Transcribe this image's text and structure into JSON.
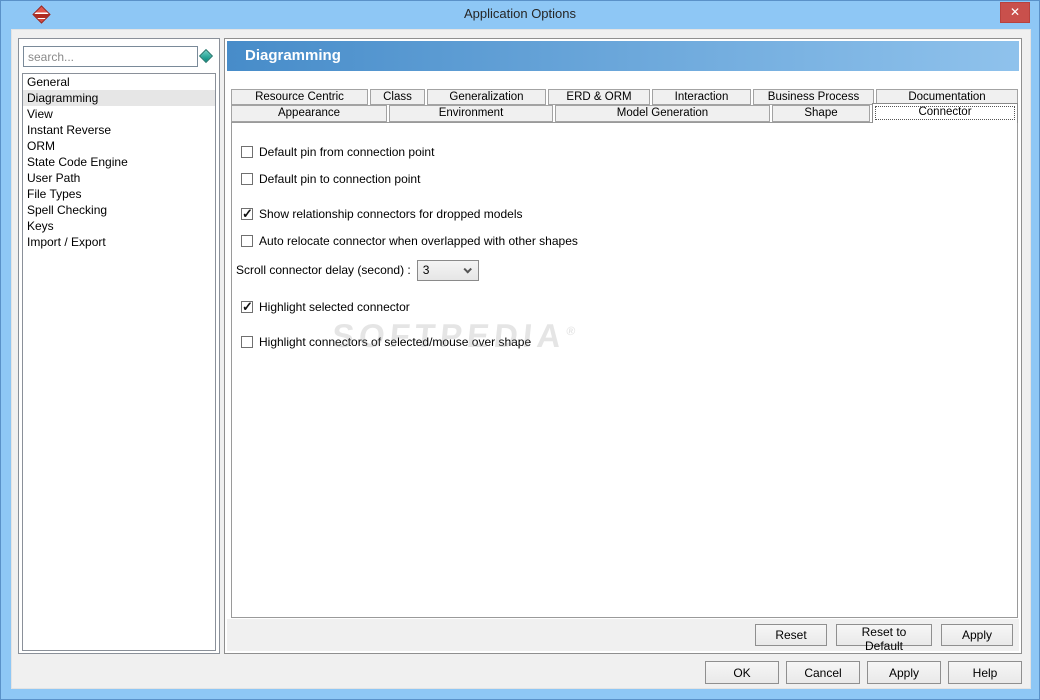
{
  "window": {
    "title": "Application Options",
    "close_glyph": "✕"
  },
  "colors": {
    "titlebar": "#8ec7f5",
    "close_button": "#c9504c",
    "header_gradient_left": "#478cc9",
    "header_gradient_right": "#8fc2ec",
    "selection": "#e6e6e6"
  },
  "sidebar": {
    "search_placeholder": "search...",
    "items": [
      {
        "label": "General",
        "selected": false
      },
      {
        "label": "Diagramming",
        "selected": true
      },
      {
        "label": "View",
        "selected": false
      },
      {
        "label": "Instant Reverse",
        "selected": false
      },
      {
        "label": "ORM",
        "selected": false
      },
      {
        "label": "State Code Engine",
        "selected": false
      },
      {
        "label": "User Path",
        "selected": false
      },
      {
        "label": "File Types",
        "selected": false
      },
      {
        "label": "Spell Checking",
        "selected": false
      },
      {
        "label": "Keys",
        "selected": false
      },
      {
        "label": "Import / Export",
        "selected": false
      }
    ]
  },
  "main": {
    "header": "Diagramming",
    "tabs": {
      "row1": [
        {
          "label": "Resource Centric",
          "selected": false
        },
        {
          "label": "Class",
          "selected": false
        },
        {
          "label": "Generalization",
          "selected": false
        },
        {
          "label": "ERD & ORM",
          "selected": false
        },
        {
          "label": "Interaction",
          "selected": false
        },
        {
          "label": "Business Process",
          "selected": false
        },
        {
          "label": "Documentation",
          "selected": false
        }
      ],
      "row2": [
        {
          "label": "Appearance",
          "selected": false
        },
        {
          "label": "Environment",
          "selected": false
        },
        {
          "label": "Model Generation",
          "selected": false
        },
        {
          "label": "Shape",
          "selected": false
        },
        {
          "label": "Connector",
          "selected": true
        }
      ]
    },
    "options": [
      {
        "label": "Default pin from connection point",
        "checked": false
      },
      {
        "label": "Default pin to connection point",
        "checked": false
      },
      {
        "label": "Show relationship connectors for dropped models",
        "checked": true
      },
      {
        "label": "Auto relocate connector when overlapped with other shapes",
        "checked": false
      },
      {
        "label": "Highlight selected connector",
        "checked": true
      },
      {
        "label": "Highlight connectors of selected/mouse over shape",
        "checked": false
      }
    ],
    "scroll_delay": {
      "label": "Scroll connector delay (second) :",
      "value": "3"
    },
    "watermark": "SOFTPEDIA",
    "watermark_mark": "®",
    "panel_buttons": [
      "Reset",
      "Reset to Default",
      "Apply"
    ]
  },
  "dialog_buttons": [
    "OK",
    "Cancel",
    "Apply",
    "Help"
  ]
}
